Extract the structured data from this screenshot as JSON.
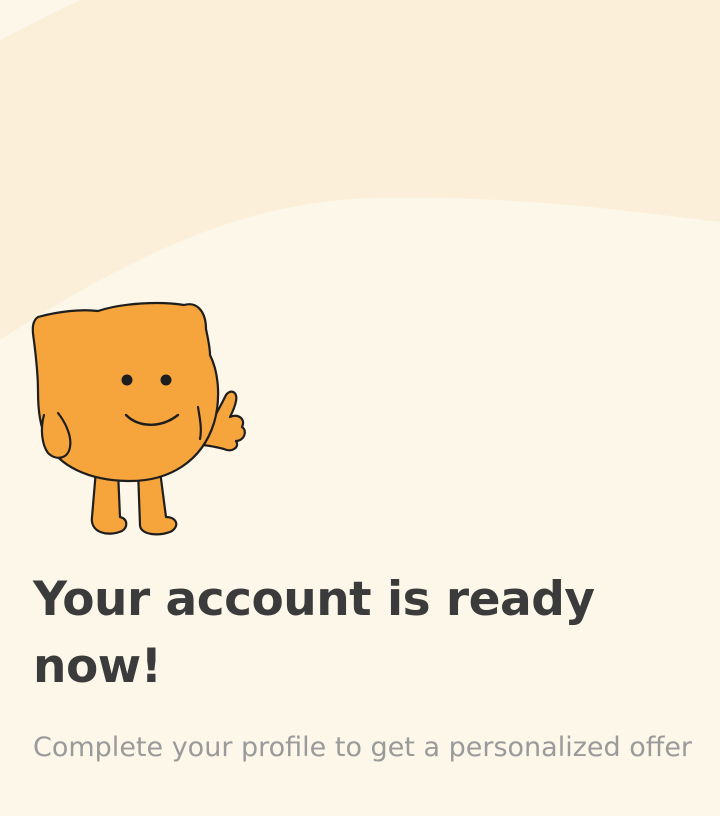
{
  "onboarding": {
    "title": "Your account is ready now!",
    "subtitle": "Complete your profile to get a personalized offer"
  },
  "theme": {
    "background": "#fdf7ea",
    "wave": "#fbefd9",
    "mascot_fill": "#f6a43c",
    "mascot_outline": "#1e1e1e",
    "title_color": "#3b3b3b",
    "subtitle_color": "#9a9a9a"
  },
  "illustration": {
    "icon": "smiling-orange-mascot-waving"
  }
}
